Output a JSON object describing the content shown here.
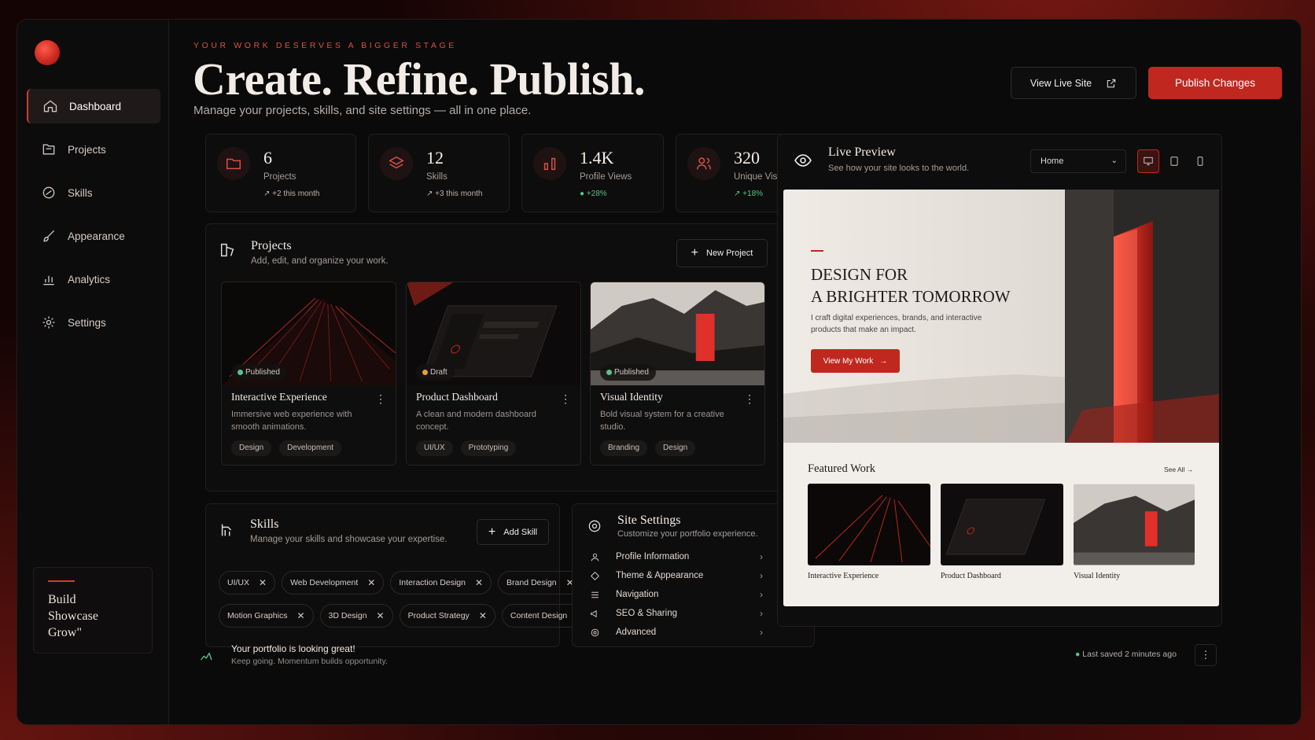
{
  "sidebar": {
    "items": [
      {
        "label": "Dashboard"
      },
      {
        "label": "Projects"
      },
      {
        "label": "Skills"
      },
      {
        "label": "Appearance"
      },
      {
        "label": "Analytics"
      },
      {
        "label": "Settings"
      }
    ],
    "motto": [
      "Build",
      "Showcase",
      "Grow\""
    ]
  },
  "header": {
    "eyebrow": "YOUR WORK DESERVES A BIGGER STAGE",
    "title": "Create. Refine. Publish.",
    "subtitle": "Manage your projects, skills, and site settings — all in one place.",
    "view_live": "View Live Site",
    "publish": "Publish Changes"
  },
  "stats": [
    {
      "value": "6",
      "label": "Projects",
      "change": "+2 this month"
    },
    {
      "value": "12",
      "label": "Skills",
      "change": "+3 this month"
    },
    {
      "value": "1.4K",
      "label": "Profile Views",
      "change": "+28%"
    },
    {
      "value": "320",
      "label": "Unique Visitors",
      "change": "+18%"
    }
  ],
  "projects": {
    "title": "Projects",
    "subtitle": "Add, edit, and organize your work.",
    "new_button": "New Project",
    "items": [
      {
        "status": "Published",
        "title": "Interactive Experience",
        "desc": "Immersive web experience with smooth animations.",
        "tags": [
          "Design",
          "Development"
        ]
      },
      {
        "status": "Draft",
        "title": "Product Dashboard",
        "desc": "A clean and modern dashboard concept.",
        "tags": [
          "UI/UX",
          "Prototyping"
        ]
      },
      {
        "status": "Published",
        "title": "Visual Identity",
        "desc": "Bold visual system for a creative studio.",
        "tags": [
          "Branding",
          "Design"
        ]
      }
    ]
  },
  "skills": {
    "title": "Skills",
    "subtitle": "Manage your skills and showcase your expertise.",
    "add_button": "Add Skill",
    "items": [
      "UI/UX",
      "Web Development",
      "Interaction Design",
      "Brand Design",
      "Motion Graphics",
      "3D Design",
      "Product Strategy",
      "Content Design"
    ]
  },
  "settings": {
    "title": "Site Settings",
    "subtitle": "Customize your portfolio experience.",
    "items": [
      "Profile Information",
      "Theme & Appearance",
      "Navigation",
      "SEO & Sharing",
      "Advanced"
    ]
  },
  "preview": {
    "title": "Live Preview",
    "subtitle": "See how your site looks to the world.",
    "page_select": "Home",
    "hero_line1": "DESIGN FOR",
    "hero_line2": "A BRIGHTER TOMORROW",
    "hero_desc": "I craft digital experiences, brands, and interactive products that make an impact.",
    "hero_cta": "View My Work",
    "featured_title": "Featured Work",
    "see_all": "See All",
    "featured": [
      "Interactive Experience",
      "Product Dashboard",
      "Visual Identity"
    ]
  },
  "footer": {
    "title": "Your portfolio is looking great!",
    "subtitle": "Keep going. Momentum builds opportunity.",
    "saved": "Last saved 2 minutes ago"
  },
  "colors": {
    "accent": "#c0281f",
    "success": "#56c48a",
    "draft": "#e0a23a"
  }
}
